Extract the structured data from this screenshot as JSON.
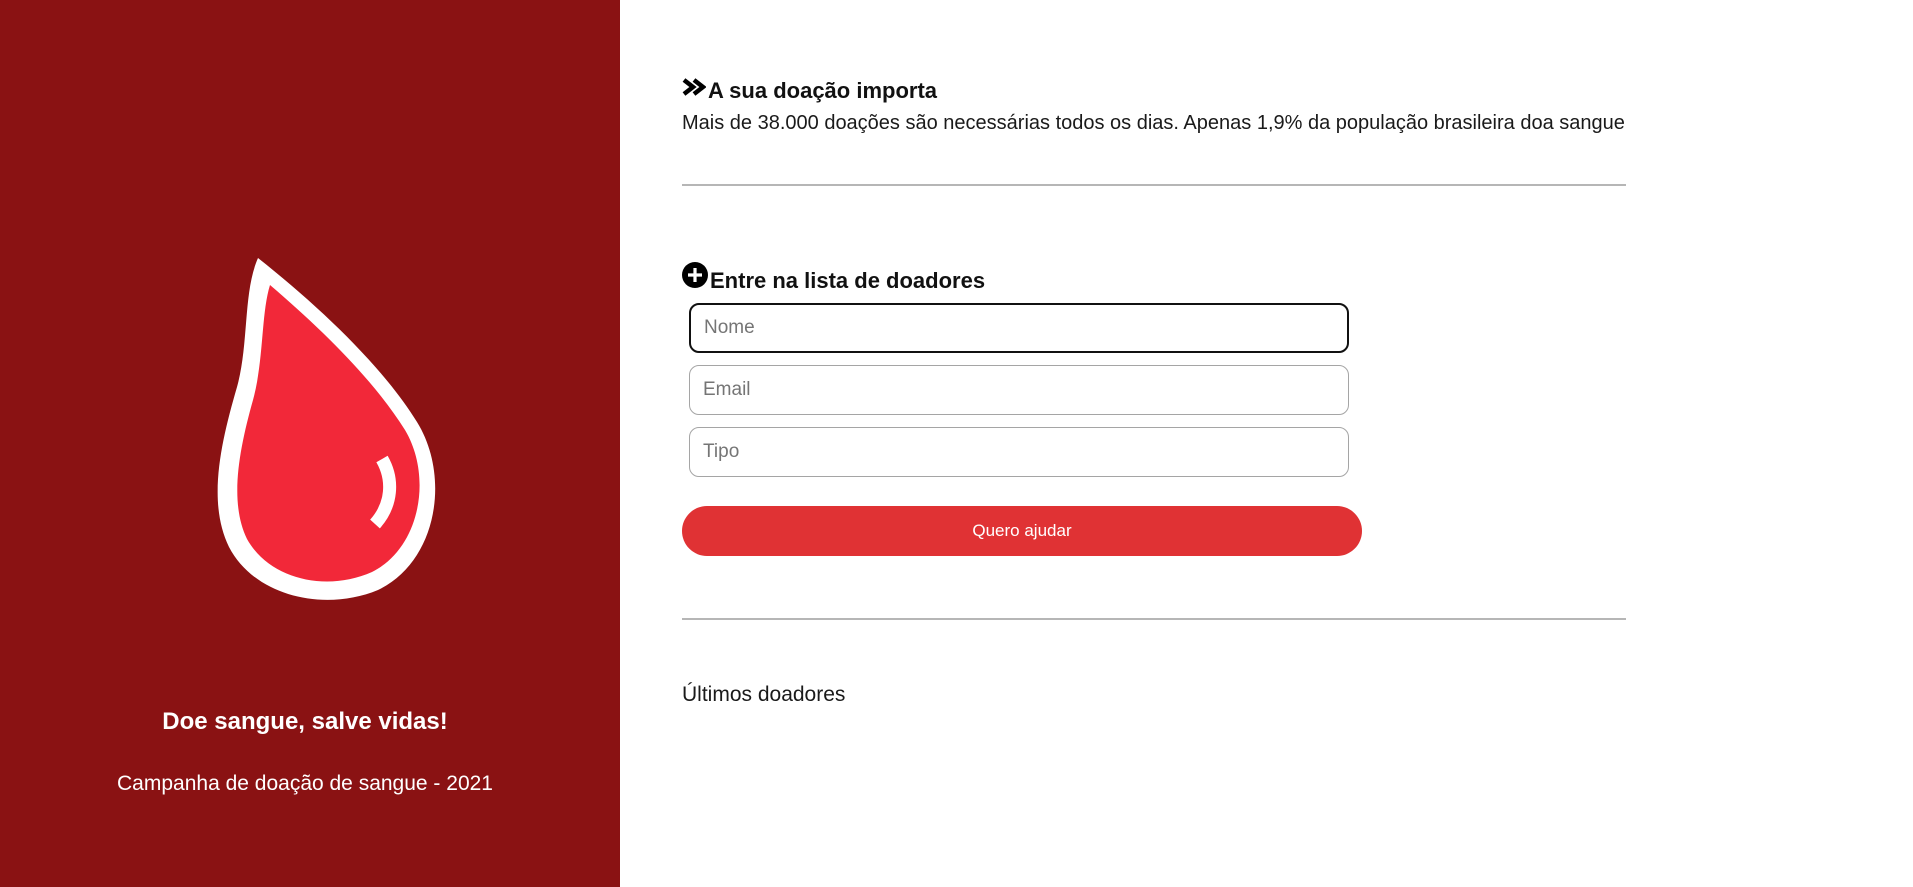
{
  "sidebar": {
    "title": "Doe sangue, salve vidas!",
    "subtitle": "Campanha de doação de sangue - 2021",
    "background_color": "#8a1213",
    "drop_icon": "blood-drop-icon",
    "drop_color": "#f22839"
  },
  "main": {
    "importance": {
      "icon": "double-chevron-right-icon",
      "heading": "A sua doação importa",
      "text": "Mais de 38.000 doações são necessárias todos os dias. Apenas 1,9% da população brasileira doa sangue"
    },
    "signup": {
      "icon": "plus-circle-icon",
      "heading": "Entre na lista de doadores",
      "name_placeholder": "Nome",
      "email_placeholder": "Email",
      "type_placeholder": "Tipo",
      "submit_label": "Quero ajudar",
      "submit_color": "#e03234"
    },
    "recent": {
      "heading": "Últimos doadores"
    }
  }
}
